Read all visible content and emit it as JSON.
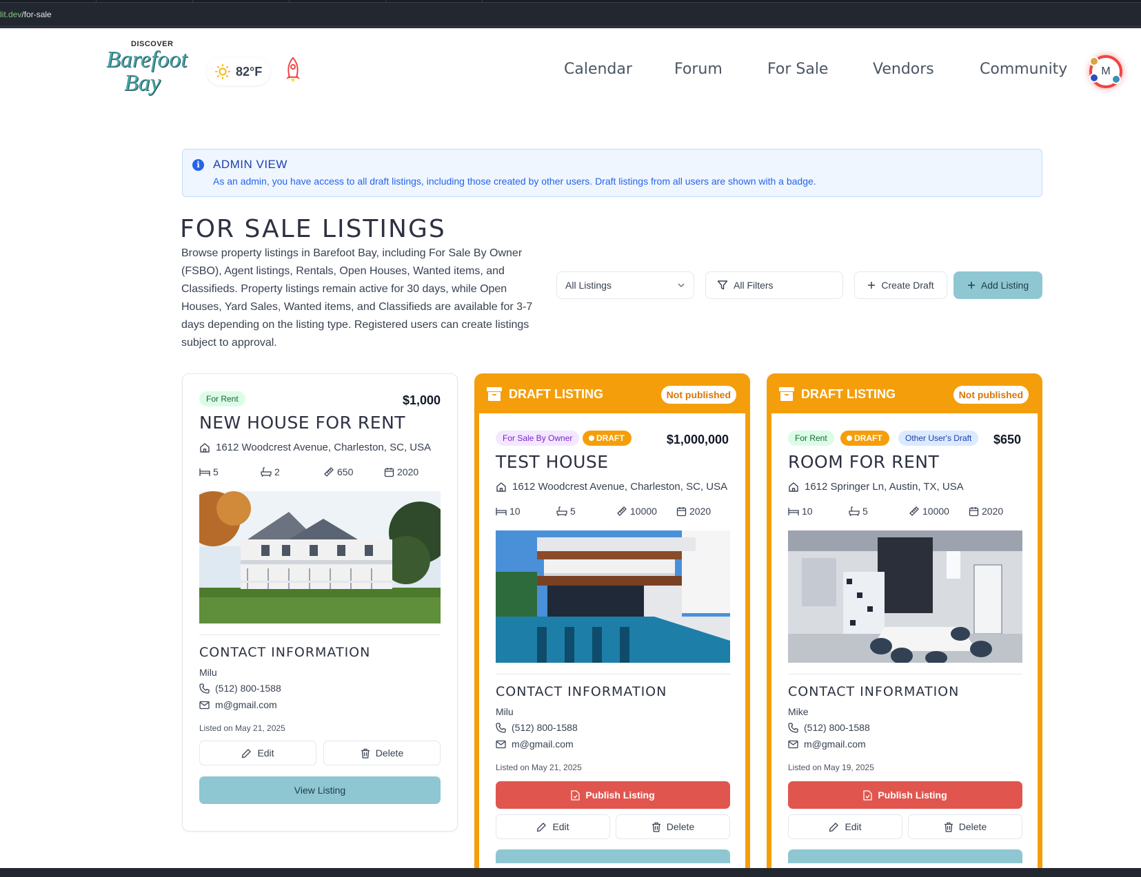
{
  "browser": {
    "url_host": "lit.dev",
    "url_path": "/for-sale"
  },
  "header": {
    "logo": {
      "top": "DISCOVER",
      "line1": "Barefoot",
      "line2": "Bay"
    },
    "weather": {
      "temp": "82°F",
      "icon": "sun-icon"
    },
    "rocket_icon": "rocket-icon",
    "nav": [
      "Calendar",
      "Forum",
      "For Sale",
      "Vendors",
      "Community"
    ],
    "avatar_initial": "M"
  },
  "admin_banner": {
    "title": "ADMIN VIEW",
    "text": "As an admin, you have access to all draft listings, including those created by other users. Draft listings from all users are shown with a badge."
  },
  "page": {
    "title": "FOR SALE LISTINGS",
    "description": "Browse property listings in Barefoot Bay, including For Sale By Owner (FSBO), Agent listings, Rentals, Open Houses, Wanted items, and Classifieds. Property listings remain active for 30 days, while Open Houses, Yard Sales, Wanted items, and Classifieds are available for 3-7 days depending on the listing type. Registered users can create listings subject to approval."
  },
  "controls": {
    "listing_select": "All Listings",
    "filters": "All Filters",
    "create_draft": "Create Draft",
    "add_listing": "Add Listing"
  },
  "draft_header": {
    "title": "DRAFT LISTING",
    "status": "Not published"
  },
  "labels": {
    "contact_heading": "CONTACT INFORMATION",
    "edit": "Edit",
    "delete": "Delete",
    "view": "View Listing",
    "publish": "Publish Listing"
  },
  "listings": [
    {
      "badges": [
        "For Rent"
      ],
      "price": "$1,000",
      "title": "NEW HOUSE FOR RENT",
      "address": "1612 Woodcrest Avenue, Charleston, SC, USA",
      "beds": "5",
      "baths": "2",
      "sqft": "650",
      "year": "2020",
      "contact_name": "Milu",
      "phone": "(512) 800-1588",
      "email": "m@gmail.com",
      "listed": "Listed on May 21, 2025"
    },
    {
      "badges": [
        "For Sale By Owner",
        "DRAFT"
      ],
      "price": "$1,000,000",
      "title": "TEST HOUSE",
      "address": "1612 Woodcrest Avenue, Charleston, SC, USA",
      "beds": "10",
      "baths": "5",
      "sqft": "10000",
      "year": "2020",
      "contact_name": "Milu",
      "phone": "(512) 800-1588",
      "email": "m@gmail.com",
      "listed": "Listed on May 21, 2025"
    },
    {
      "badges": [
        "For Rent",
        "DRAFT",
        "Other User's Draft"
      ],
      "price": "$650",
      "title": "ROOM FOR RENT",
      "address": "1612 Springer Ln, Austin, TX, USA",
      "beds": "10",
      "baths": "5",
      "sqft": "10000",
      "year": "2020",
      "contact_name": "Mike",
      "phone": "(512) 800-1588",
      "email": "m@gmail.com",
      "listed": "Listed on May 19, 2025"
    }
  ]
}
